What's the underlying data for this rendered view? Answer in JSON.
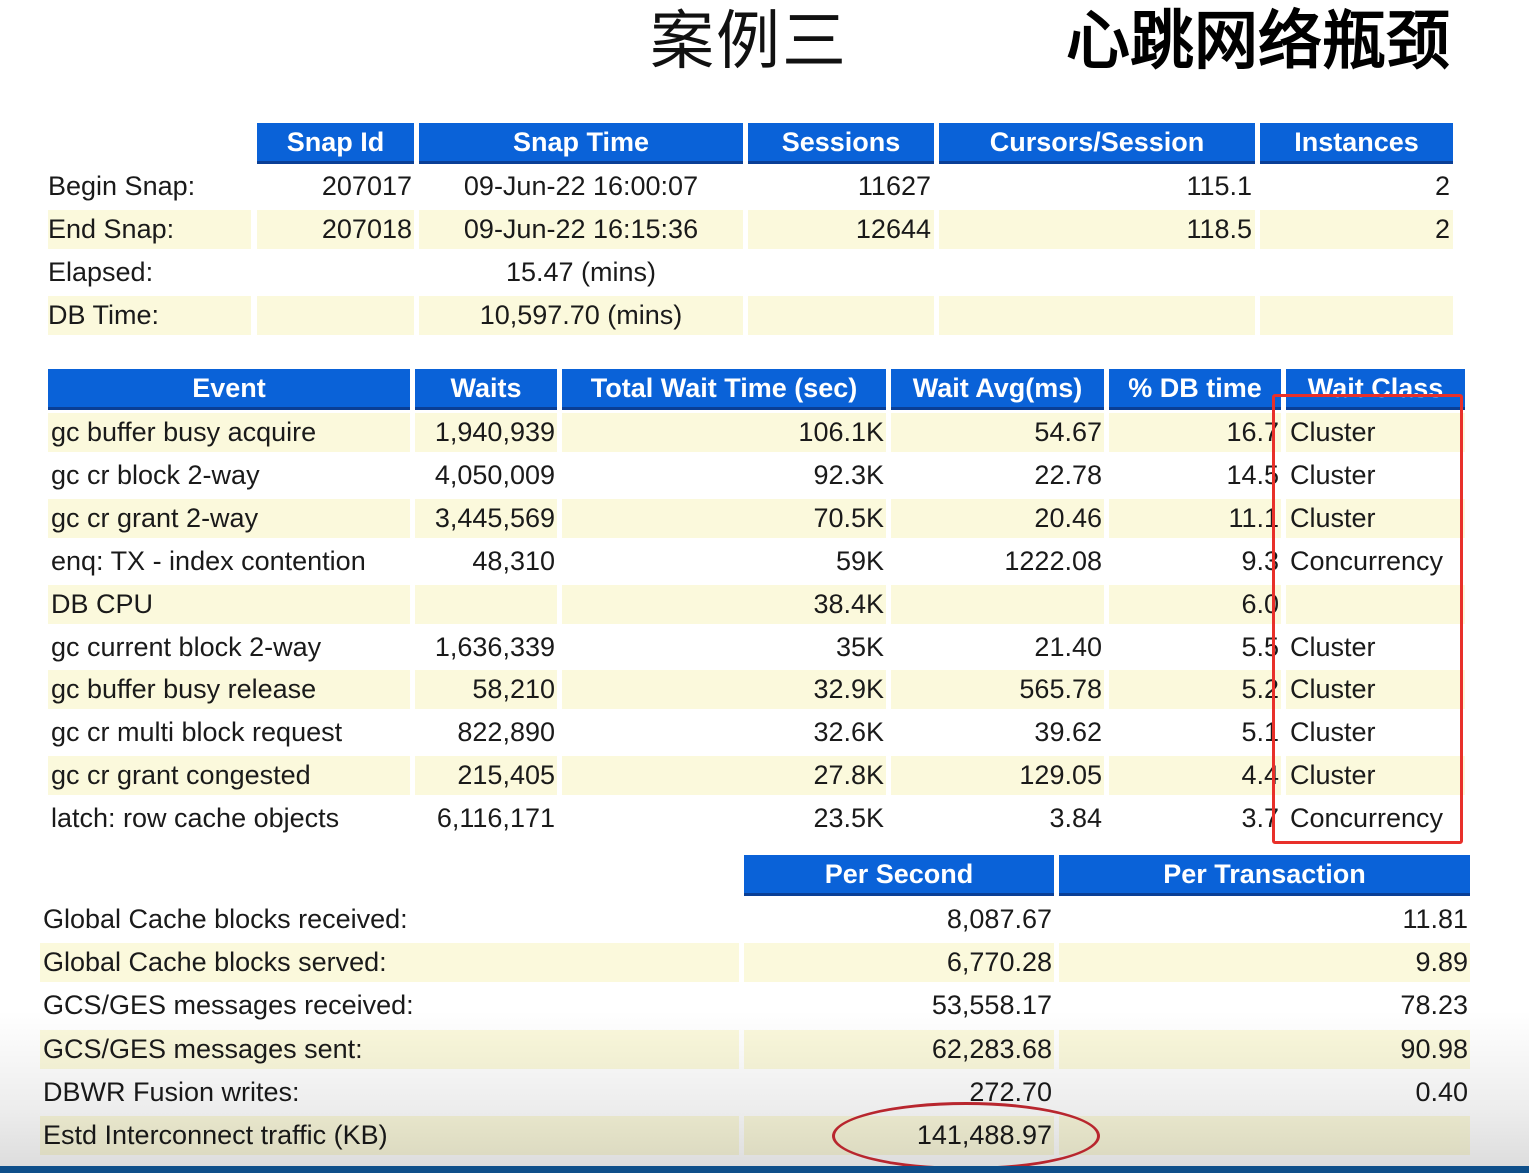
{
  "title": {
    "left": "案例三",
    "right": "心跳网络瓶颈"
  },
  "snap_table": {
    "headers": [
      "Snap Id",
      "Snap Time",
      "Sessions",
      "Cursors/Session",
      "Instances"
    ],
    "rows": [
      {
        "label": "Begin Snap:",
        "snap_id": "207017",
        "snap_time": "09-Jun-22 16:00:07",
        "sessions": "11627",
        "cursors": "115.1",
        "instances": "2"
      },
      {
        "label": "End Snap:",
        "snap_id": "207018",
        "snap_time": "09-Jun-22 16:15:36",
        "sessions": "12644",
        "cursors": "118.5",
        "instances": "2"
      },
      {
        "label": "Elapsed:",
        "snap_time": "15.47 (mins)"
      },
      {
        "label": "DB Time:",
        "snap_time": "10,597.70 (mins)"
      }
    ]
  },
  "event_table": {
    "headers": [
      "Event",
      "Waits",
      "Total Wait Time (sec)",
      "Wait Avg(ms)",
      "% DB time",
      "Wait Class"
    ],
    "rows": [
      {
        "event": "gc buffer busy acquire",
        "waits": "1,940,939",
        "total": "106.1K",
        "avg": "54.67",
        "pct": "16.7",
        "cls": "Cluster"
      },
      {
        "event": "gc cr block 2-way",
        "waits": "4,050,009",
        "total": "92.3K",
        "avg": "22.78",
        "pct": "14.5",
        "cls": "Cluster"
      },
      {
        "event": "gc cr grant 2-way",
        "waits": "3,445,569",
        "total": "70.5K",
        "avg": "20.46",
        "pct": "11.1",
        "cls": "Cluster"
      },
      {
        "event": "enq: TX - index contention",
        "waits": "48,310",
        "total": "59K",
        "avg": "1222.08",
        "pct": "9.3",
        "cls": "Concurrency"
      },
      {
        "event": "DB CPU",
        "waits": "",
        "total": "38.4K",
        "avg": "",
        "pct": "6.0",
        "cls": ""
      },
      {
        "event": "gc current block 2-way",
        "waits": "1,636,339",
        "total": "35K",
        "avg": "21.40",
        "pct": "5.5",
        "cls": "Cluster"
      },
      {
        "event": "gc buffer busy release",
        "waits": "58,210",
        "total": "32.9K",
        "avg": "565.78",
        "pct": "5.2",
        "cls": "Cluster"
      },
      {
        "event": "gc cr multi block request",
        "waits": "822,890",
        "total": "32.6K",
        "avg": "39.62",
        "pct": "5.1",
        "cls": "Cluster"
      },
      {
        "event": "gc cr grant congested",
        "waits": "215,405",
        "total": "27.8K",
        "avg": "129.05",
        "pct": "4.4",
        "cls": "Cluster"
      },
      {
        "event": "latch: row cache objects",
        "waits": "6,116,171",
        "total": "23.5K",
        "avg": "3.84",
        "pct": "3.7",
        "cls": "Concurrency"
      }
    ]
  },
  "gc_table": {
    "headers": [
      "Per Second",
      "Per Transaction"
    ],
    "rows": [
      {
        "label": "Global Cache blocks received:",
        "per_sec": "8,087.67",
        "per_txn": "11.81"
      },
      {
        "label": "Global Cache blocks served:",
        "per_sec": "6,770.28",
        "per_txn": "9.89"
      },
      {
        "label": "GCS/GES messages received:",
        "per_sec": "53,558.17",
        "per_txn": "78.23"
      },
      {
        "label": "GCS/GES messages sent:",
        "per_sec": "62,283.68",
        "per_txn": "90.98"
      },
      {
        "label": "DBWR Fusion writes:",
        "per_sec": "272.70",
        "per_txn": "0.40"
      },
      {
        "label": "Estd Interconnect traffic (KB)",
        "per_sec": "141,488.97",
        "per_txn": ""
      }
    ]
  },
  "annotations": {
    "rect_color": "#e8302a",
    "ellipse_color": "#b8262e"
  },
  "colors": {
    "header_bg": "#0a62d8",
    "row_shade": "#fbf9dc"
  }
}
